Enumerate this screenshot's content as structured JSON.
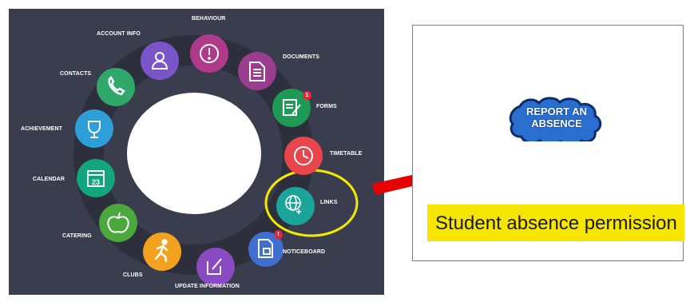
{
  "app_menu": {
    "items": [
      {
        "key": "behaviour",
        "label": "BEHAVIOUR",
        "icon": "exclamation-circle-icon",
        "color": "#b03a8a"
      },
      {
        "key": "documents",
        "label": "DOCUMENTS",
        "icon": "document-icon",
        "color": "#9a3d8e"
      },
      {
        "key": "forms",
        "label": "FORMS",
        "icon": "form-edit-icon",
        "color": "#1f9a55",
        "badge": "1"
      },
      {
        "key": "timetable",
        "label": "TIMETABLE",
        "icon": "clock-icon",
        "color": "#e8454c"
      },
      {
        "key": "links",
        "label": "LINKS",
        "icon": "globe-link-icon",
        "color": "#1aa49a"
      },
      {
        "key": "noticeboard",
        "label": "NOTICEBOARD",
        "icon": "noticeboard-icon",
        "color": "#3f6fd0",
        "badge": "!"
      },
      {
        "key": "update-information",
        "label": "UPDATE INFORMATION",
        "icon": "pencil-square-icon",
        "color": "#8a4bc2"
      },
      {
        "key": "clubs",
        "label": "CLUBS",
        "icon": "running-person-icon",
        "color": "#f2a21e"
      },
      {
        "key": "catering",
        "label": "CATERING",
        "icon": "apple-icon",
        "color": "#4aa83e"
      },
      {
        "key": "calendar",
        "label": "CALENDAR",
        "icon": "calendar-icon",
        "color": "#13a57c",
        "icon_text": "23"
      },
      {
        "key": "achievement",
        "label": "ACHIEVEMENT",
        "icon": "trophy-icon",
        "color": "#2d9fd8"
      },
      {
        "key": "contacts",
        "label": "CONTACTS",
        "icon": "phone-icon",
        "color": "#2fa86a"
      },
      {
        "key": "account-info",
        "label": "ACCOUNT INFO",
        "icon": "user-icon",
        "color": "#7a55c9"
      }
    ],
    "highlight_color": "#f2ea00"
  },
  "callout_arrow": {
    "color": "#e60000"
  },
  "report_card": {
    "button_text": "REPORT AN ABSENCE",
    "button_color": "#2a6fd0",
    "caption": "Student absence permission",
    "caption_highlight": "#f6e500"
  }
}
